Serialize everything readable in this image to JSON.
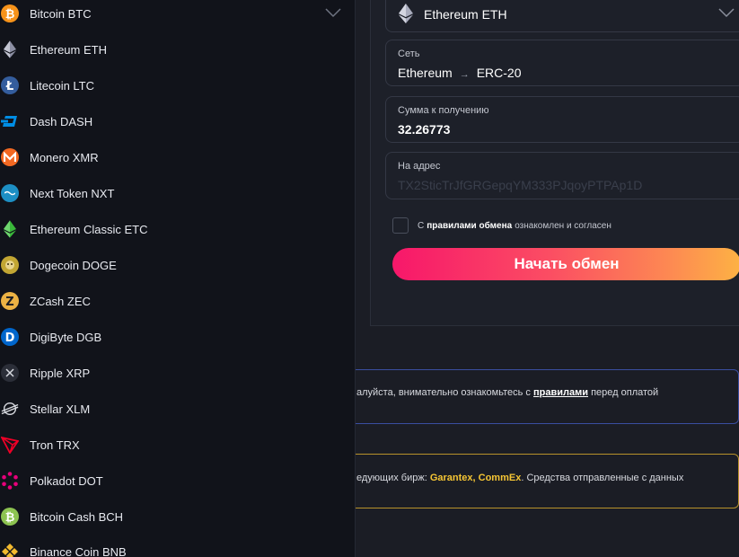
{
  "coins": [
    {
      "label": "Bitcoin BTC",
      "icon": "bitcoin-icon",
      "color": "#f7931a"
    },
    {
      "label": "Ethereum ETH",
      "icon": "ethereum-icon",
      "color": "#8c8fa3"
    },
    {
      "label": "Litecoin LTC",
      "icon": "litecoin-icon",
      "color": "#345d9d"
    },
    {
      "label": "Dash DASH",
      "icon": "dash-icon",
      "color": "#008de4"
    },
    {
      "label": "Monero XMR",
      "icon": "monero-icon",
      "color": "#f26822"
    },
    {
      "label": "Next Token NXT",
      "icon": "nxt-icon",
      "color": "#1d8fc4"
    },
    {
      "label": "Ethereum Classic ETC",
      "icon": "ethereum-classic-icon",
      "color": "#3ab83a"
    },
    {
      "label": "Dogecoin DOGE",
      "icon": "dogecoin-icon",
      "color": "#c2a633"
    },
    {
      "label": "ZCash ZEC",
      "icon": "zcash-icon",
      "color": "#ecb244"
    },
    {
      "label": "DigiByte DGB",
      "icon": "digibyte-icon",
      "color": "#0066cc"
    },
    {
      "label": "Ripple XRP",
      "icon": "ripple-icon",
      "color": "#2b2e38"
    },
    {
      "label": "Stellar XLM",
      "icon": "stellar-icon",
      "color": "#d8dae0"
    },
    {
      "label": "Tron TRX",
      "icon": "tron-icon",
      "color": "#ef0027"
    },
    {
      "label": "Polkadot DOT",
      "icon": "polkadot-icon",
      "color": "#e6007a"
    },
    {
      "label": "Bitcoin Cash BCH",
      "icon": "bitcoin-cash-icon",
      "color": "#8dc351"
    },
    {
      "label": "Binance Coin BNB",
      "icon": "binance-icon",
      "color": "#f3ba2f"
    }
  ],
  "receive": {
    "currency": "Ethereum ETH",
    "network_label": "Сеть",
    "network_from": "Ethereum",
    "network_arrow": "→",
    "network_to": "ERC-20",
    "amount_label": "Сумма к получению",
    "amount_value": "32.26773",
    "address_label": "На адрес",
    "address_placeholder": "TX2SticTrJfGRGepqYM333PJqoyPTPAp1D"
  },
  "agree": {
    "prefix": "С",
    "link": "правилами обмена",
    "suffix": "ознакомлен и согласен"
  },
  "start_button": "Начать обмен",
  "notices": {
    "rules_prefix": "алуйста, внимательно ознакомьтесь с",
    "rules_link": "правилами",
    "rules_suffix": "перед оплатой",
    "exchanges_prefix": "едующих бирж:",
    "exchanges_names": "Garantex, CommEx",
    "exchanges_suffix": ". Средства отправленные с данных"
  },
  "colors": {
    "accent_gradient_start": "#f7176a",
    "accent_gradient_end": "#fdb244",
    "rules_border": "#3a4ea0",
    "warning_border": "#b8922b",
    "warning_highlight": "#f5c534"
  }
}
